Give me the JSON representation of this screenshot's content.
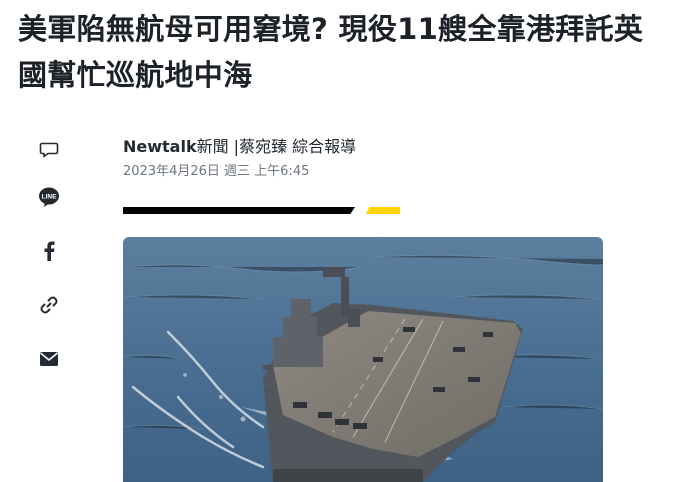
{
  "article": {
    "headline": "美軍陷無航母可用窘境? 現役11艘全靠港拜託英國幫忙巡航地中海",
    "byline_brand": "Newtalk",
    "byline_rest": "新聞 |蔡宛臻 綜合報導",
    "dateline": "2023年4月26日 週三 上午6:45"
  },
  "share": {
    "items": [
      "comment-icon",
      "line-icon",
      "facebook-icon",
      "link-icon",
      "mail-icon"
    ],
    "line_label": "LINE"
  },
  "colors": {
    "accent_yellow": "#ffd400",
    "divider_black": "#000000",
    "icon_gray": "#232a31"
  },
  "hero_image": {
    "subject": "aircraft-carrier-photo"
  }
}
